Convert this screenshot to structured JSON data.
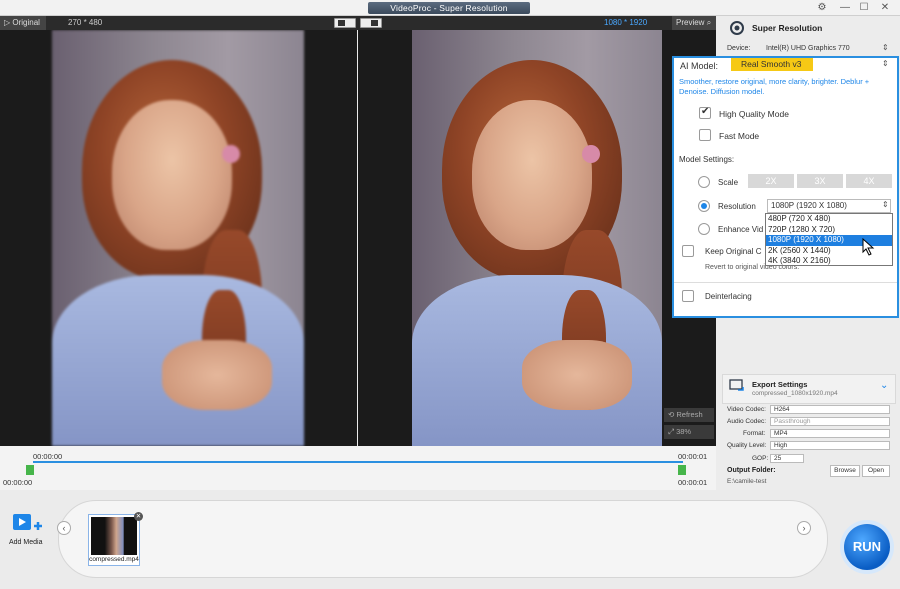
{
  "window": {
    "title": "VideoProc - Super Resolution"
  },
  "preview": {
    "original_tab": "Original",
    "original_res": "270 * 480",
    "output_res": "1080 * 1920",
    "preview_tab": "Preview",
    "refresh": "Refresh",
    "zoom": "38%"
  },
  "panel": {
    "title": "Super Resolution",
    "device_label": "Device:",
    "device_value": "Intel(R) UHD Graphics 770",
    "ai_model_label": "AI Model:",
    "ai_model_value": "Real Smooth v3",
    "ai_desc": "Smoother, restore original, more clarity, brighter. Deblur + Denoise. Diffusion model.",
    "high_quality": "High Quality Mode",
    "fast_mode": "Fast Mode",
    "model_settings": "Model Settings:",
    "scale": "Scale",
    "scale_options": [
      "2X",
      "3X",
      "4X"
    ],
    "resolution": "Resolution",
    "resolution_value": "1080P (1920 X 1080)",
    "resolution_options": [
      "480P (720 X 480)",
      "720P (1280 X 720)",
      "1080P (1920 X 1080)",
      "2K (2560 X 1440)",
      "4K (3840 X 2160)"
    ],
    "enhance_video": "Enhance Vid",
    "keep_original": "Keep Original C",
    "revert_text": "Revert to original video colors.",
    "deinterlacing": "Deinterlacing"
  },
  "export": {
    "title": "Export Settings",
    "filename": "compressed_1080x1920.mp4",
    "video_codec_label": "Video Codec:",
    "video_codec": "H264",
    "audio_codec_label": "Audio Codec:",
    "audio_codec": "Passthrough",
    "format_label": "Format:",
    "format": "MP4",
    "quality_label": "Quality Level:",
    "quality": "High",
    "gop_label": "GOP:",
    "gop": "25",
    "output_folder_label": "Output Folder:",
    "output_folder": "E:\\camile-test",
    "browse": "Browse",
    "open": "Open"
  },
  "timeline": {
    "start_top": "00:00:00",
    "end_top": "00:00:01",
    "start_bottom": "00:00:00",
    "end_bottom": "00:00:01"
  },
  "media": {
    "add_media": "Add Media",
    "clip_name": "compressed.mp4",
    "run": "RUN"
  },
  "colors": {
    "accent": "#2a8fe0",
    "model_highlight": "#f6c915",
    "selected": "#1e7fe0"
  }
}
